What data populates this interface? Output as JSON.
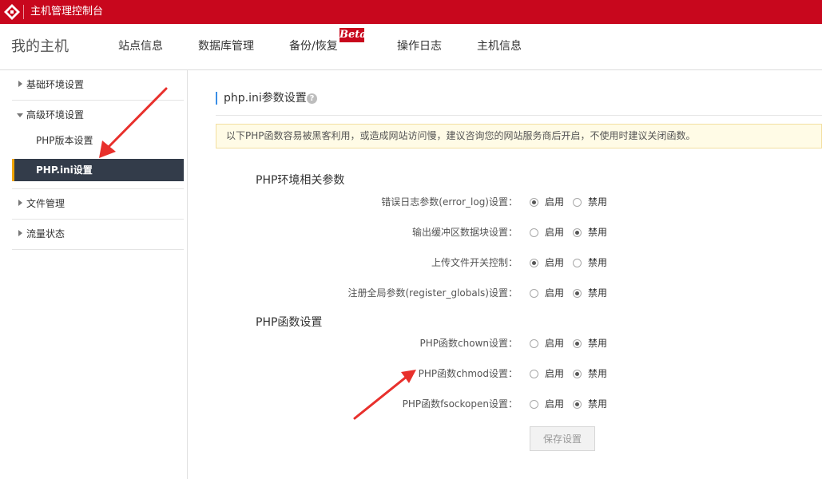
{
  "app": {
    "title": "主机管理控制台"
  },
  "nav": {
    "brand": "我的主机",
    "items": [
      "站点信息",
      "数据库管理",
      "备份/恢复",
      "操作日志",
      "主机信息"
    ],
    "beta_badge": "Beta"
  },
  "sidebar": {
    "groups": [
      {
        "label": "基础环境设置",
        "expanded": false
      },
      {
        "label": "高级环境设置",
        "expanded": true,
        "children": [
          "PHP版本设置",
          "PHP.ini设置"
        ],
        "active_child": "PHP.ini设置"
      },
      {
        "label": "文件管理",
        "expanded": false
      },
      {
        "label": "流量状态",
        "expanded": false
      }
    ]
  },
  "content": {
    "section_title": "php.ini参数设置",
    "help_icon": "?",
    "notice": "以下PHP函数容易被黑客利用，或造成网站访问慢，建议咨询您的网站服务商后开启，不使用时建议关闭函数。",
    "radio_labels": {
      "on": "启用",
      "off": "禁用"
    },
    "groups": [
      {
        "title": "PHP环境相关参数",
        "options": [
          {
            "label": "错误日志参数(error_log)设置：",
            "value": "on"
          },
          {
            "label": "输出缓冲区数据块设置：",
            "value": "off"
          },
          {
            "label": "上传文件开关控制：",
            "value": "on"
          },
          {
            "label": "注册全局参数(register_globals)设置：",
            "value": "off"
          }
        ]
      },
      {
        "title": "PHP函数设置",
        "options": [
          {
            "label": "PHP函数chown设置：",
            "value": "off"
          },
          {
            "label": "PHP函数chmod设置：",
            "value": "off"
          },
          {
            "label": "PHP函数fsockopen设置：",
            "value": "off"
          }
        ]
      }
    ],
    "save_label": "保存设置"
  },
  "colors": {
    "brand_red": "#c8071d",
    "active_bg": "#333c4a",
    "active_accent": "#f0a500",
    "notice_bg": "#fffbe6",
    "annotation_red": "#e8302c"
  }
}
